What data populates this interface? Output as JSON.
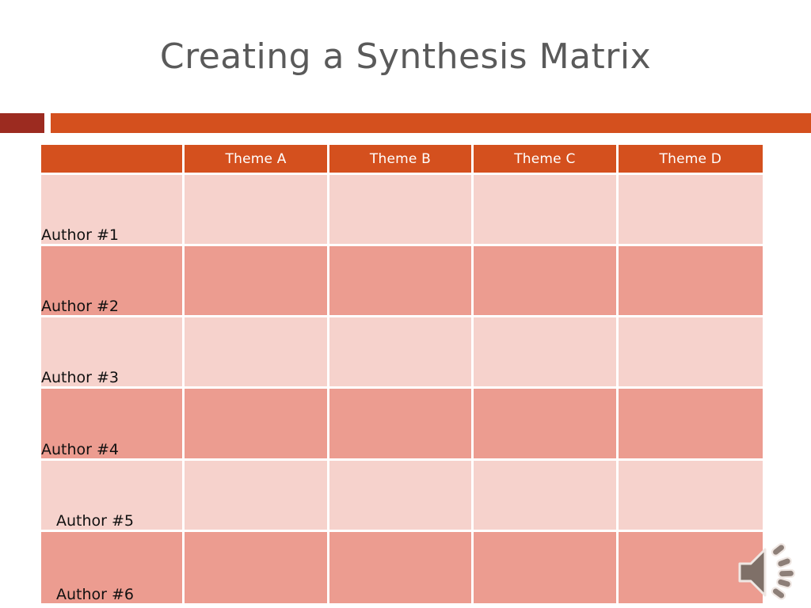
{
  "slide": {
    "title": "Creating a Synthesis Matrix"
  },
  "theme_colors": {
    "title_text": "#5a5a5a",
    "accent_dark_red": "#9c2b20",
    "accent_orange": "#d4501e",
    "row_light": "#f6d2cc",
    "row_dark": "#ec9c90",
    "header_text": "#ffffff",
    "body_text": "#101010",
    "icon_gray": "#7f7068"
  },
  "matrix": {
    "corner_label": "",
    "columns": [
      {
        "label": "Theme A"
      },
      {
        "label": "Theme B"
      },
      {
        "label": "Theme C"
      },
      {
        "label": "Theme D"
      }
    ],
    "rows": [
      {
        "author": "Author #1",
        "shade": "light",
        "indented": false,
        "cells": [
          "",
          "",
          "",
          ""
        ]
      },
      {
        "author": "Author #2",
        "shade": "dark",
        "indented": false,
        "cells": [
          "",
          "",
          "",
          ""
        ]
      },
      {
        "author": "Author #3",
        "shade": "light",
        "indented": false,
        "cells": [
          "",
          "",
          "",
          ""
        ]
      },
      {
        "author": "Author #4",
        "shade": "dark",
        "indented": false,
        "cells": [
          "",
          "",
          "",
          ""
        ]
      },
      {
        "author": "Author #5",
        "shade": "light",
        "indented": true,
        "cells": [
          "",
          "",
          "",
          ""
        ]
      },
      {
        "author": "Author #6",
        "shade": "dark",
        "indented": true,
        "cells": [
          "",
          "",
          "",
          ""
        ]
      }
    ]
  },
  "media": {
    "audio_icon": "speaker-icon"
  }
}
